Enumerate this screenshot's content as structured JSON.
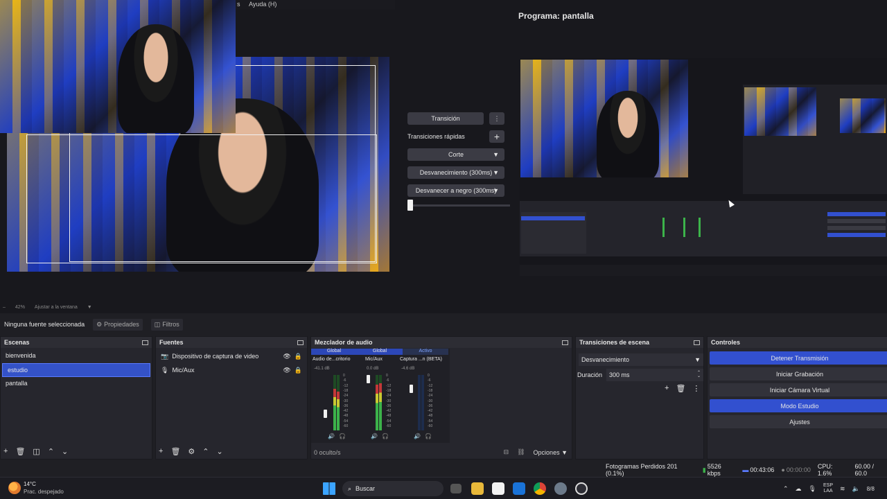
{
  "menu": {
    "help_label": "Ayuda (H)",
    "partial": "s"
  },
  "program": {
    "title": "Programa: pantalla"
  },
  "preview_footer": {
    "zoom": "42%",
    "fit_label": "Ajustar a la ventana"
  },
  "transitions_panel": {
    "transition_label": "Transición",
    "quick_label": "Transiciones rápidas",
    "items": [
      "Corte",
      "Desvanecimiento (300ms)",
      "Desvanecer a negro (300ms)"
    ]
  },
  "source_bar": {
    "no_source": "Ninguna fuente seleccionada",
    "properties": "Propiedades",
    "filters": "Filtros"
  },
  "scenes": {
    "title": "Escenas",
    "items": [
      "bienvenida",
      "estudio",
      "pantalla"
    ]
  },
  "sources": {
    "title": "Fuentes",
    "items": [
      "Dispositivo de captura de video",
      "Mic/Aux"
    ]
  },
  "mixer": {
    "title": "Mezclador de audio",
    "hidden_count": "0 oculto/s",
    "options_label": "Opciones",
    "channels": [
      {
        "tag": "Global",
        "name": "Audio de...critorio",
        "db": "-41.1 dB",
        "level": 0.22
      },
      {
        "tag": "Global",
        "name": "Mic/Aux",
        "db": "0.0 dB",
        "level": 0.55
      },
      {
        "tag": "Activo",
        "name": "Captura ...n (BETA)",
        "db": "-4.6 dB",
        "level": 0.0
      }
    ],
    "scale": [
      "0",
      "-6",
      "-12",
      "-18",
      "-24",
      "-30",
      "-36",
      "-42",
      "-48",
      "-54",
      "-60"
    ]
  },
  "scene_transitions": {
    "title": "Transiciones de escena",
    "selected": "Desvanecimiento",
    "duration_label": "Duración",
    "duration_value": "300 ms"
  },
  "controls": {
    "title": "Controles",
    "buttons": [
      "Detener Transmisión",
      "Iniciar Grabación",
      "Iniciar Cámara Virtual",
      "Modo Estudio",
      "Ajustes"
    ]
  },
  "status": {
    "dropped": "Fotogramas Perdidos 201 (0.1%)",
    "bitrate": "5526 kbps",
    "stream_time": "00:43:06",
    "rec_time": "00:00:00",
    "cpu": "CPU: 1.6%",
    "fps": "60.00 / 60.0"
  },
  "taskbar": {
    "weather_temp": "14°C",
    "weather_desc": "Prac. despejado",
    "search": "Buscar",
    "lang1": "ESP",
    "lang2": "LAA",
    "clock": "8/8"
  },
  "colors": {
    "accent": "#3250cf",
    "panel": "#26262d",
    "bg": "#1f1f24"
  }
}
